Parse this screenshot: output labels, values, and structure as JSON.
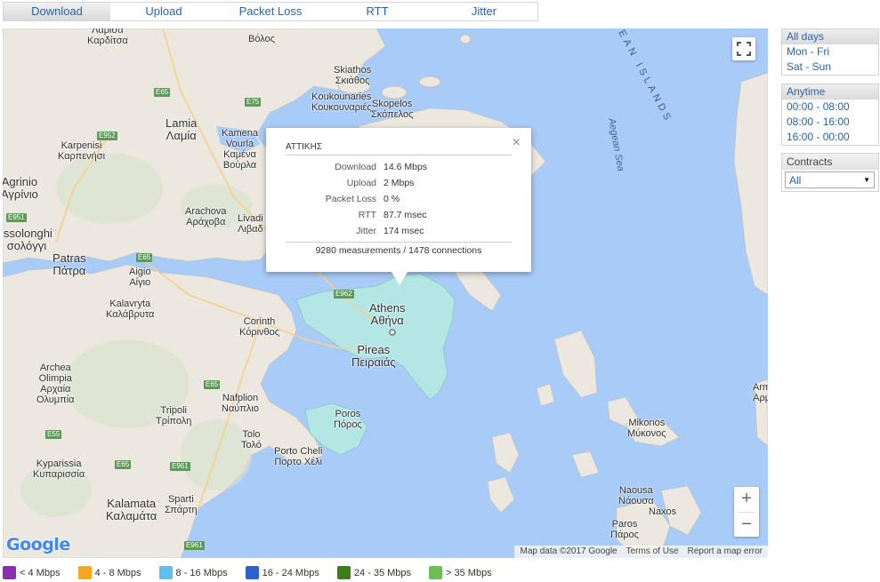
{
  "tabs": [
    {
      "label": "Download",
      "active": true
    },
    {
      "label": "Upload"
    },
    {
      "label": "Packet Loss"
    },
    {
      "label": "RTT"
    },
    {
      "label": "Jitter"
    }
  ],
  "days": {
    "items": [
      {
        "label": "All days",
        "active": true
      },
      {
        "label": "Mon - Fri"
      },
      {
        "label": "Sat - Sun"
      }
    ]
  },
  "times": {
    "items": [
      {
        "label": "Anytime",
        "active": true
      },
      {
        "label": "00:00 - 08:00"
      },
      {
        "label": "08:00 - 16:00"
      },
      {
        "label": "16:00 - 00:00"
      }
    ]
  },
  "contracts": {
    "title": "Contracts",
    "selected": "All"
  },
  "popup": {
    "region": "ΑΤΤΙΚΗΣ",
    "rows": [
      {
        "key": "Download",
        "value": "14.6 Mbps"
      },
      {
        "key": "Upload",
        "value": "2 Mbps"
      },
      {
        "key": "Packet Loss",
        "value": "0 %"
      },
      {
        "key": "RTT",
        "value": "87.7 msec"
      },
      {
        "key": "Jitter",
        "value": "174 msec"
      }
    ],
    "summary": "9280 measurements / 1478 connections",
    "close": "×"
  },
  "map": {
    "places": {
      "larissa": "Λάρισα",
      "karditsa": "Καρδίτσα",
      "volos": "Βόλος",
      "skiathos_en": "Skiathos",
      "skiathos_gr": "Σκιάθος",
      "koukounaries_en": "Koukounaries",
      "koukounaries_gr": "Κουκουναριές",
      "skopelos_en": "Skopelos",
      "skopelos_gr": "Σκόπελος",
      "lamia_en": "Lamia",
      "lamia_gr": "Λαμία",
      "kamena_en": "Kamena",
      "kamena_gr": "Vourla",
      "kamena_gr2": "Καμένα",
      "kamena_gr3": "Βούρλα",
      "karpenisi_en": "Karpenisi",
      "karpenisi_gr": "Καρπενήσι",
      "agrinio_en": "Agrinio",
      "agrinio_gr": "Αγρίνιο",
      "arachova_en": "Arachova",
      "arachova_gr": "Αράχοβα",
      "livadi_en": "Livadi",
      "livadi_gr": "Λιβαδ",
      "missolonghi_en": "issolonghi",
      "missolonghi_gr": "σολόγγι",
      "patras_en": "Patras",
      "patras_gr": "Πάτρα",
      "aigio_en": "Aigio",
      "aigio_gr": "Αίγιο",
      "kalavryta_en": "Kalavryta",
      "kalavryta_gr": "Καλάβρυτα",
      "corinth_en": "Corinth",
      "corinth_gr": "Κόρινθος",
      "athens_en": "Athens",
      "athens_gr": "Αθήνα",
      "pireas_en": "Pireas",
      "pireas_gr": "Πειραιάς",
      "archea_en": "Archea",
      "archea_en2": "Olimpia",
      "archea_gr": "Αρχαία",
      "archea_gr2": "Ολυμπία",
      "nafplion_en": "Nafplion",
      "nafplion_gr": "Ναύπλιο",
      "tripoli_en": "Tripoli",
      "tripoli_gr": "Τρίπολη",
      "poros_en": "Poros",
      "poros_gr": "Πόρος",
      "tolo_en": "Tolo",
      "tolo_gr": "Τολό",
      "portocheli_en": "Porto Cheli",
      "portocheli_gr": "Πορτο Χέλι",
      "kyparissia_en": "Kyparissia",
      "kyparissia_gr": "Κυπαρισσία",
      "sparti_en": "Sparti",
      "sparti_gr": "Σπάρτη",
      "kalamata_en": "Kalamata",
      "kalamata_gr": "Καλαμάτα",
      "mikonos_en": "Mikonos",
      "mikonos_gr": "Μύκονος",
      "naousa_en": "Naousa",
      "naousa_gr": "Νάουσα",
      "naxos_en": "Naxos",
      "paros_en": "Paros",
      "paros_gr": "Πάρος",
      "aegean_sea": "Aegean Sea",
      "aegean_islands": "EAN ISLANDS",
      "arm_en": "Arm",
      "arm_gr": "Αρμ"
    },
    "roads": [
      "E65",
      "E75",
      "E952",
      "E951",
      "E65",
      "E962",
      "E65",
      "E55",
      "E65",
      "E961",
      "E961"
    ],
    "attribution": [
      "Map data ©2017 Google",
      "Terms of Use",
      "Report a map error"
    ],
    "logo": "Google",
    "zoom_in": "+",
    "zoom_out": "−"
  },
  "legend": [
    {
      "label": "< 4 Mbps",
      "color": "#8b2fb0"
    },
    {
      "label": "4 - 8 Mbps",
      "color": "#f5a623"
    },
    {
      "label": "8 - 16 Mbps",
      "color": "#5bc0eb"
    },
    {
      "label": "16 - 24 Mbps",
      "color": "#2f5fd1"
    },
    {
      "label": "24 - 35 Mbps",
      "color": "#3f7d19"
    },
    {
      "label": "> 35 Mbps",
      "color": "#6fbe55"
    }
  ],
  "colors": {
    "accent": "#2a63a8",
    "sea": "#a9cbf7",
    "land": "#ece8df",
    "region_fill": "#b5e6e6"
  }
}
